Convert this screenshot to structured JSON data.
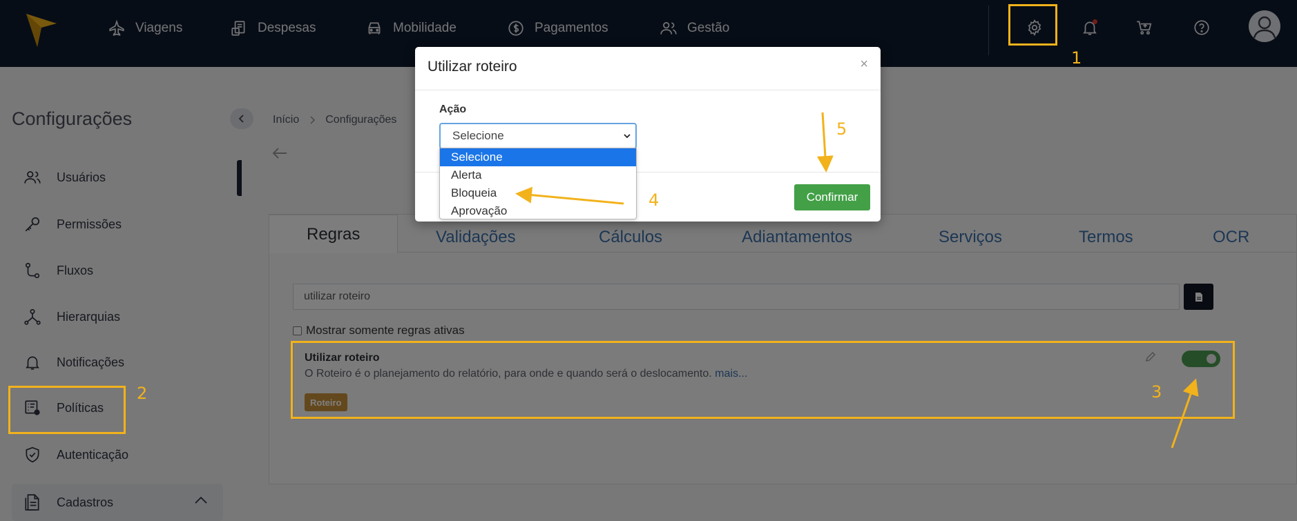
{
  "topbar": {
    "nav": [
      {
        "label": "Viagens",
        "icon": "plane-icon"
      },
      {
        "label": "Despesas",
        "icon": "receipt-icon"
      },
      {
        "label": "Mobilidade",
        "icon": "car-icon"
      },
      {
        "label": "Pagamentos",
        "icon": "dollar-icon"
      },
      {
        "label": "Gestão",
        "icon": "users-icon"
      }
    ],
    "icons": [
      "gear-icon",
      "bell-icon",
      "cart-icon",
      "help-icon",
      "avatar"
    ]
  },
  "sidebar": {
    "title": "Configurações",
    "items": [
      {
        "label": "Usuários",
        "icon": "users-icon"
      },
      {
        "label": "Permissões",
        "icon": "key-icon"
      },
      {
        "label": "Fluxos",
        "icon": "flow-icon"
      },
      {
        "label": "Hierarquias",
        "icon": "hierarchy-icon"
      },
      {
        "label": "Notificações",
        "icon": "bell-icon"
      },
      {
        "label": "Políticas",
        "icon": "policy-icon"
      },
      {
        "label": "Autenticação",
        "icon": "shield-icon"
      }
    ],
    "cadastros": "Cadastros"
  },
  "breadcrumb": [
    "Início",
    "Configurações"
  ],
  "tabs": [
    "Regras",
    "Validações",
    "Cálculos",
    "Adiantamentos",
    "Serviços",
    "Termos",
    "OCR"
  ],
  "search": {
    "value": "utilizar roteiro"
  },
  "filter": {
    "label": "Mostrar somente regras ativas"
  },
  "rule": {
    "title": "Utilizar roteiro",
    "description": "O Roteiro é o planejamento do relatório, para onde e quando será o deslocamento.",
    "more": "mais...",
    "tag": "Roteiro"
  },
  "modal": {
    "title": "Utilizar roteiro",
    "close": "×",
    "field_label": "Ação",
    "select_value": "Selecione",
    "options": [
      "Selecione",
      "Alerta",
      "Bloqueia",
      "Aprovação"
    ],
    "confirm": "Confirmar"
  },
  "annotations": [
    "1",
    "2",
    "3",
    "4",
    "5"
  ],
  "colors": {
    "topbar": "#0f1b2d",
    "accent": "#f2b21b",
    "confirm": "#43a047",
    "tab_link": "#3a6ea8"
  }
}
